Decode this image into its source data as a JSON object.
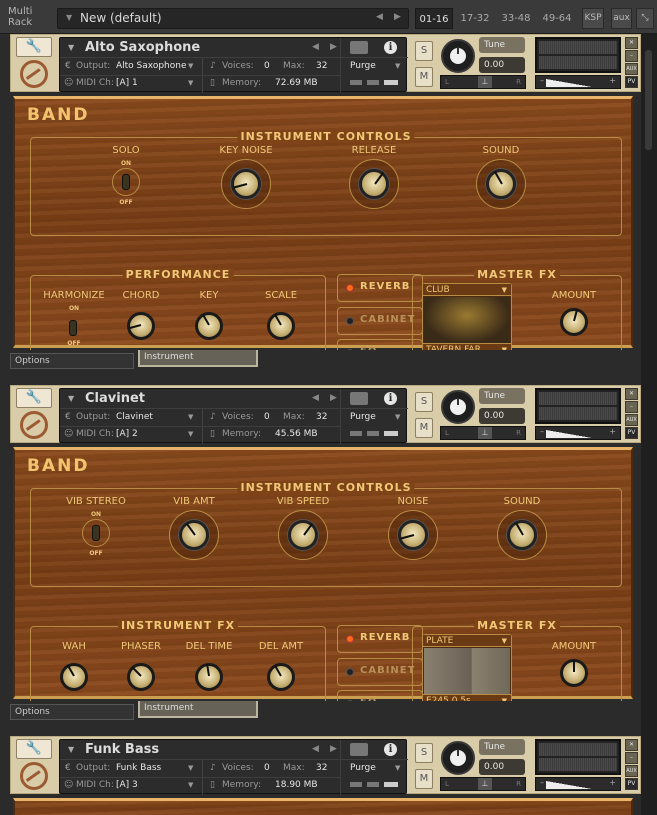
{
  "topbar": {
    "multirack_label_line1": "Multi",
    "multirack_label_line2": "Rack",
    "preset_name": "New (default)",
    "ranges": [
      "01-16",
      "17-32",
      "33-48",
      "49-64"
    ],
    "active_range": "01-16",
    "ksp_label": "KSP",
    "aux_label": "aux",
    "collapse_icon": "collapse-arrows-icon"
  },
  "common": {
    "output_label": "Output:",
    "midi_label": "MIDI Ch:",
    "voices_label": "Voices:",
    "max_label": "Max:",
    "memory_label": "Memory:",
    "purge_label": "Purge",
    "solo_label": "S",
    "mute_label": "M",
    "tune_label": "Tune",
    "pan_left": "L",
    "pan_right": "R",
    "vol_minus": "–",
    "vol_plus": "+",
    "side_close": "✕",
    "side_min": "–",
    "side_aux": "AUX",
    "side_pv": "PV",
    "band_title": "BAND",
    "tab_options": "Options",
    "tab_instrument": "Instrument",
    "toggle_on": "ON",
    "toggle_off": "OFF",
    "master_fx_title": "MASTER FX",
    "reverb_label": "REVERB",
    "cabinet_label": "CABINET",
    "eq_label": "EQ",
    "amount_label": "AMOUNT"
  },
  "instruments": [
    {
      "name": "Alto Saxophone",
      "output": "Alto Saxophone",
      "midi_channel": "[A]  1",
      "voices": "0",
      "max": "32",
      "memory": "72.69 MB",
      "tune": "0.00",
      "instrument_controls_title": "INSTRUMENT CONTROLS",
      "instrument_controls": [
        {
          "type": "toggle",
          "label": "SOLO",
          "state": "on"
        },
        {
          "type": "knob",
          "label": "KEY NOISE",
          "value": 0.15
        },
        {
          "type": "knob",
          "label": "RELEASE",
          "value": 0.62
        },
        {
          "type": "knob",
          "label": "SOUND",
          "value": 0.4
        }
      ],
      "performance_title": "PERFORMANCE",
      "performance": [
        {
          "type": "toggle",
          "label": "HARMONIZE",
          "state": "off"
        },
        {
          "type": "knob",
          "label": "CHORD",
          "value": 0.15
        },
        {
          "type": "knob",
          "label": "KEY",
          "value": 0.4
        },
        {
          "type": "knob",
          "label": "SCALE",
          "value": 0.4
        }
      ],
      "reverb_on": true,
      "cabinet_on": false,
      "eq_on": false,
      "reverb_type": "CLUB",
      "reverb_preset": "TAVERN FAR",
      "amount": 0.55
    },
    {
      "name": "Clavinet",
      "output": "Clavinet",
      "midi_channel": "[A]  2",
      "voices": "0",
      "max": "32",
      "memory": "45.56 MB",
      "tune": "0.00",
      "instrument_controls_title": "INSTRUMENT CONTROLS",
      "instrument_controls": [
        {
          "type": "toggle",
          "label": "VIB STEREO",
          "state": "on"
        },
        {
          "type": "knob",
          "label": "VIB AMT",
          "value": 0.38
        },
        {
          "type": "knob",
          "label": "VIB SPEED",
          "value": 0.62
        },
        {
          "type": "knob",
          "label": "NOISE",
          "value": 0.15
        },
        {
          "type": "knob",
          "label": "SOUND",
          "value": 0.4
        }
      ],
      "performance_title": "INSTRUMENT FX",
      "performance": [
        {
          "type": "knob",
          "label": "WAH",
          "value": 0.4
        },
        {
          "type": "knob",
          "label": "PHASER",
          "value": 0.35
        },
        {
          "type": "knob",
          "label": "DEL TIME",
          "value": 0.47
        },
        {
          "type": "knob",
          "label": "DEL AMT",
          "value": 0.4
        }
      ],
      "reverb_on": true,
      "cabinet_on": false,
      "eq_on": false,
      "reverb_type": "PLATE",
      "reverb_preset": "E245 0.5s",
      "amount": 0.5
    },
    {
      "name": "Funk Bass",
      "output": "Funk Bass",
      "midi_channel": "[A]  3",
      "voices": "0",
      "max": "32",
      "memory": "18.90 MB",
      "tune": "0.00"
    }
  ]
}
